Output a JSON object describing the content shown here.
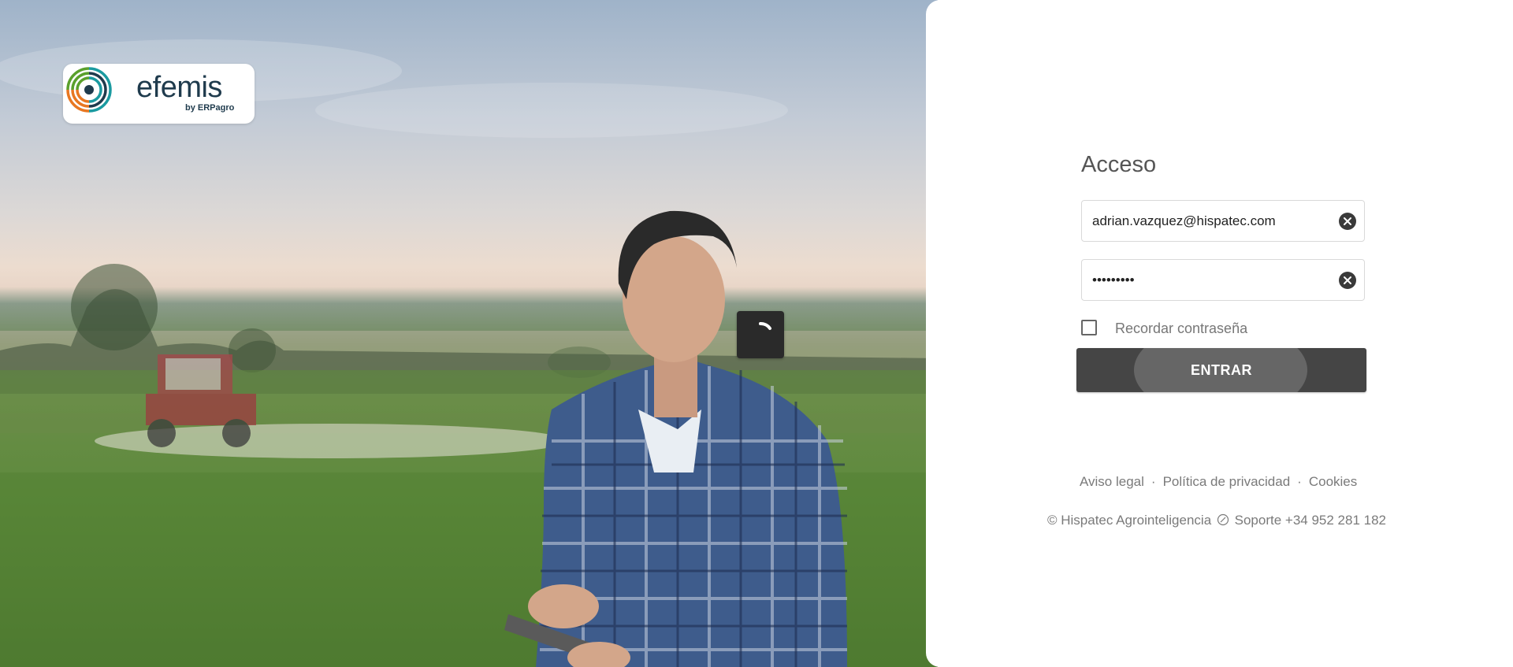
{
  "branding": {
    "logo_name": "efemis",
    "logo_tagline": "by ERPagro"
  },
  "login": {
    "title": "Acceso",
    "email_value": "adrian.vazquez@hispatec.com",
    "password_value": "•••••••••",
    "remember_label": "Recordar contraseña",
    "remember_checked": false,
    "submit_label": "ENTRAR"
  },
  "legal_links": {
    "aviso_legal": "Aviso legal",
    "privacidad": "Política de privacidad",
    "cookies": "Cookies",
    "separator": "·"
  },
  "footer": {
    "copyright": "© Hispatec Agrointeligencia",
    "support": "Soporte +34 952 281 182"
  },
  "icons": {
    "clear": "close-circle-icon",
    "phone": "phone-icon",
    "spinner": "loading-spinner-icon"
  },
  "colors": {
    "button_bg": "#454545",
    "text_muted": "#7a7a7a",
    "brand_dark": "#1f3b4d",
    "brand_green": "#5aa02c",
    "brand_orange": "#e87722",
    "brand_teal": "#1a9aa0"
  }
}
